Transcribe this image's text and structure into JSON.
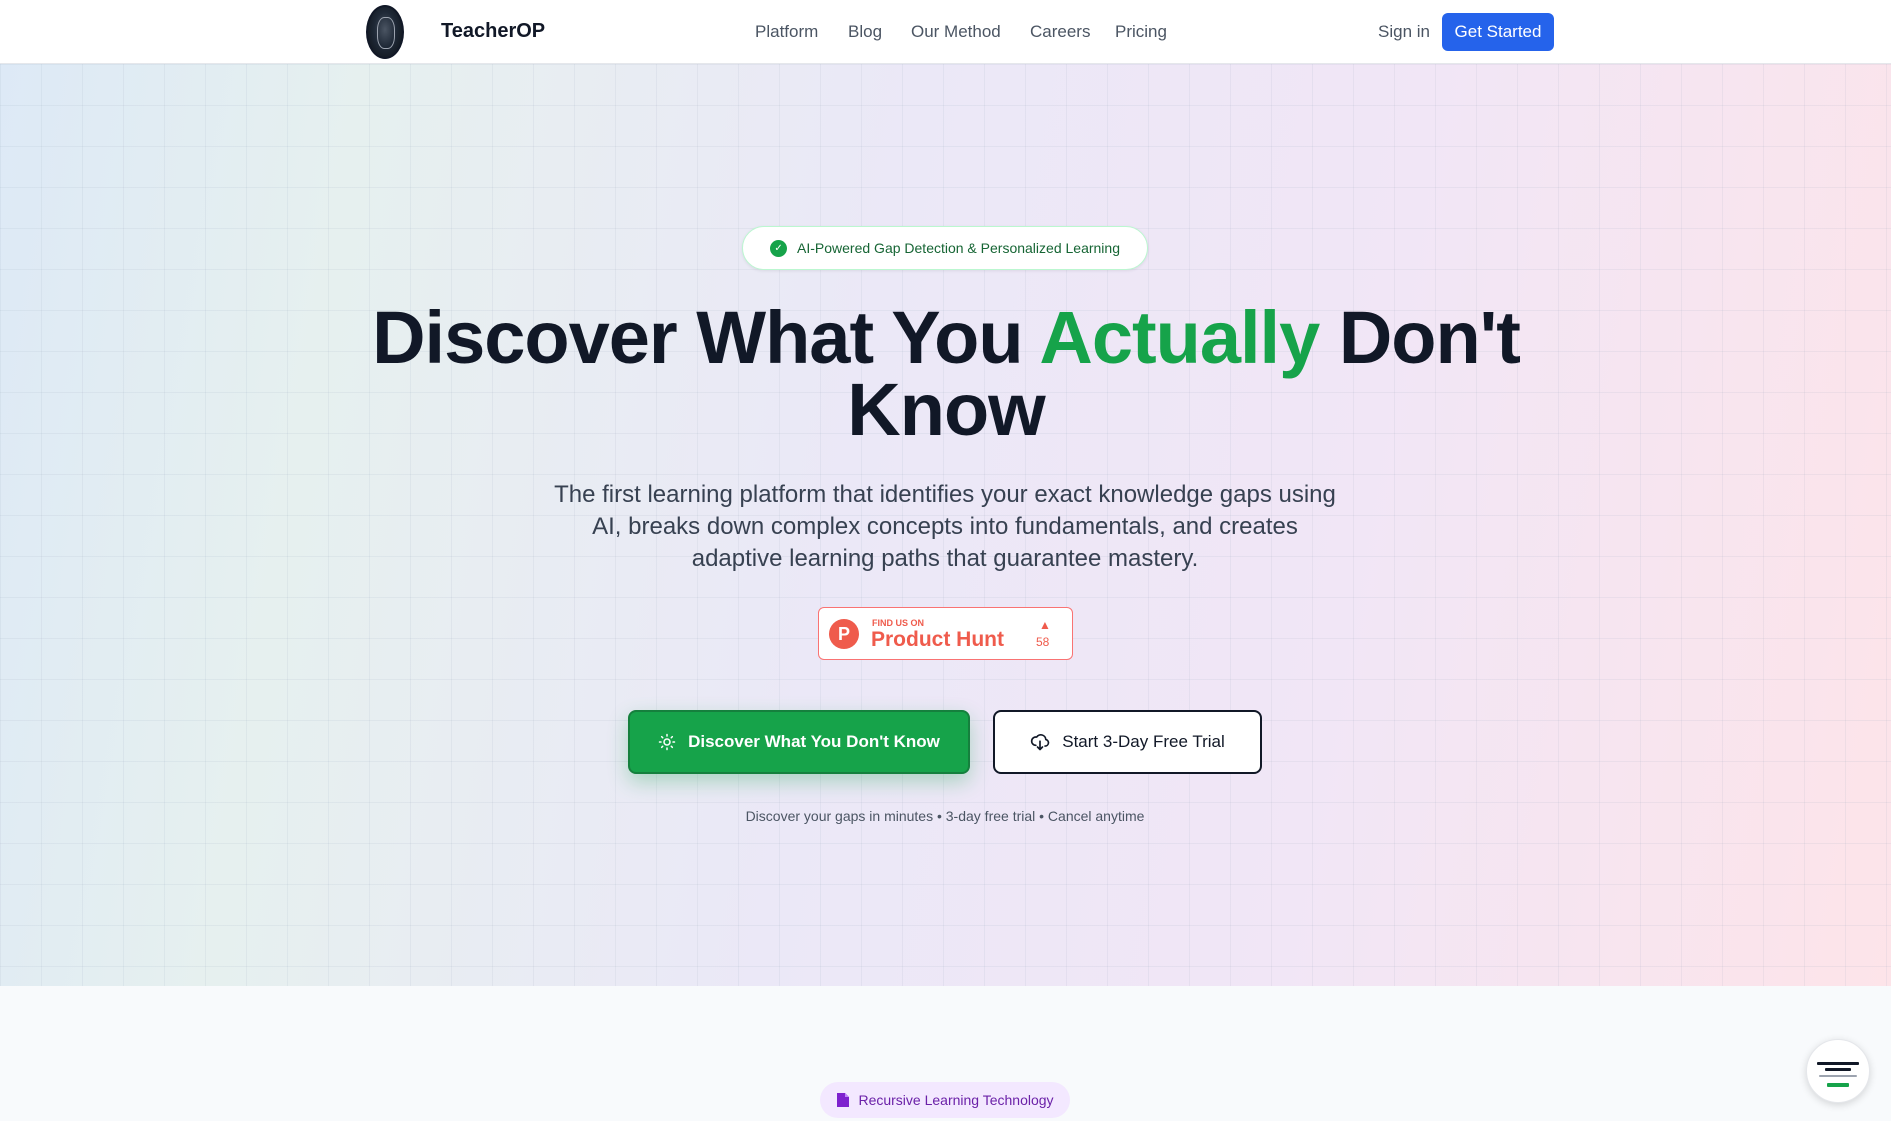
{
  "nav": {
    "brand": "TeacherOP",
    "links": [
      "Platform",
      "Blog",
      "Our Method",
      "Careers",
      "Pricing"
    ],
    "sign_in": "Sign in",
    "get_started": "Get Started"
  },
  "hero": {
    "badge": "AI-Powered Gap Detection & Personalized Learning",
    "headline_part1": "Discover What You ",
    "headline_accent": "Actually",
    "headline_part2": " Don't Know",
    "subtext": "The first learning platform that identifies your exact knowledge gaps using AI, breaks down complex concepts into fundamentals, and creates adaptive learning paths that guarantee mastery.",
    "product_hunt": {
      "small": "FIND US ON",
      "big": "Product Hunt",
      "count": "58"
    },
    "cta_primary": "Discover What You Don't Know",
    "cta_secondary": "Start 3-Day Free Trial",
    "note": "Discover your gaps in minutes • 3-day free trial • Cancel anytime"
  },
  "section": {
    "badge": "Recursive Learning Technology"
  },
  "colors": {
    "accent_green": "#16a34a",
    "primary_blue": "#2563eb",
    "product_hunt": "#ef5b4c",
    "purple": "#6b21a8"
  },
  "icons": {
    "badge": "check-badge-icon",
    "cta_primary": "lightbulb-icon",
    "cta_secondary": "cloud-download-icon",
    "section_badge": "document-icon",
    "product_hunt": "product-hunt-logo",
    "upvote": "triangle-up-icon"
  }
}
